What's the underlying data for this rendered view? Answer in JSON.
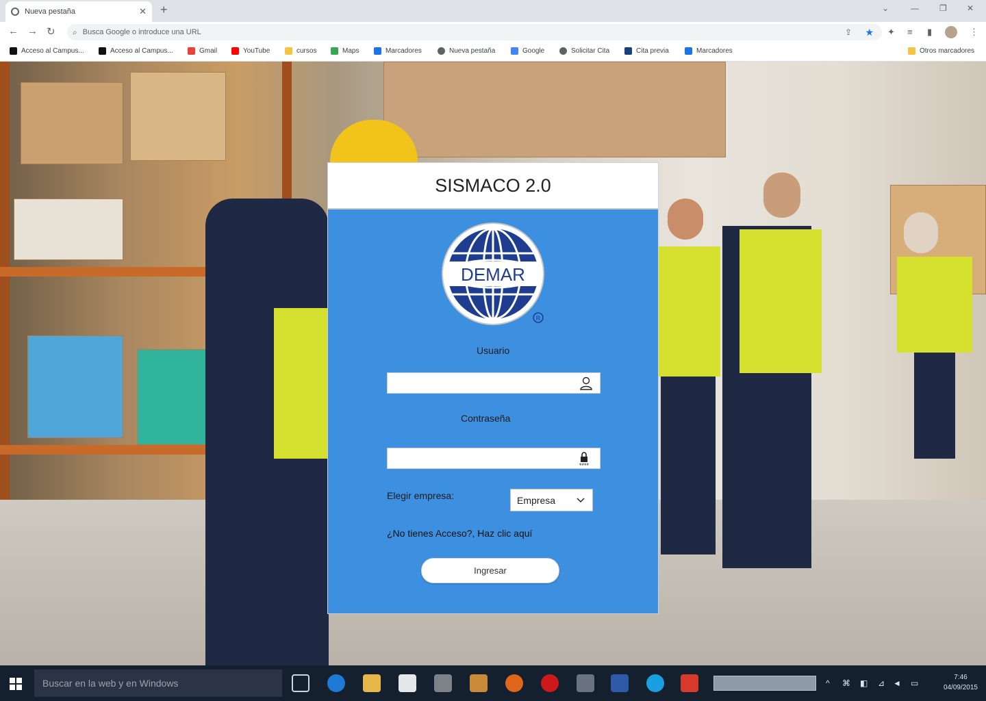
{
  "browser": {
    "tab_title": "Nueva pestaña",
    "tab_close": "✕",
    "new_tab": "+",
    "address_placeholder": "Busca Google o introduce una URL",
    "bookmarks": [
      {
        "label": "Acceso al Campus...",
        "icon_color": "#111111"
      },
      {
        "label": "Acceso al Campus...",
        "icon_color": "#111111"
      },
      {
        "label": "Gmail",
        "icon_color": "#ea4335"
      },
      {
        "label": "YouTube",
        "icon_color": "#ff0000"
      },
      {
        "label": "cursos",
        "icon_color": "#f6c445"
      },
      {
        "label": "Maps",
        "icon_color": "#34a853"
      },
      {
        "label": "Marcadores",
        "icon_color": "#1a73e8"
      },
      {
        "label": "Nueva pestaña",
        "icon_color": "#5f6368"
      },
      {
        "label": "Google",
        "icon_color": "#4285f4"
      },
      {
        "label": "Solicitar Cita",
        "icon_color": "#5f6368"
      },
      {
        "label": "Cita previa",
        "icon_color": "#1a3f7a"
      },
      {
        "label": "Marcadores",
        "icon_color": "#1a73e8"
      }
    ],
    "other_bookmarks": "Otros marcadores"
  },
  "login": {
    "title": "SISMACO 2.0",
    "logo_text": "DEMAR",
    "logo_mark": "R",
    "user_label": "Usuario",
    "user_value": "",
    "password_label": "Contraseña",
    "password_value": "",
    "company_label": "Elegir empresa:",
    "company_selected": "Empresa",
    "no_access_link": "¿No tienes Acceso?, Haz clic aquí",
    "submit_label": "Ingresar"
  },
  "taskbar": {
    "search_placeholder": "Buscar en la web y en Windows",
    "time": "7:46",
    "date": "04/09/2015"
  },
  "colors": {
    "panel_blue": "#3d8fdf",
    "logo_blue": "#1e3d8f"
  }
}
